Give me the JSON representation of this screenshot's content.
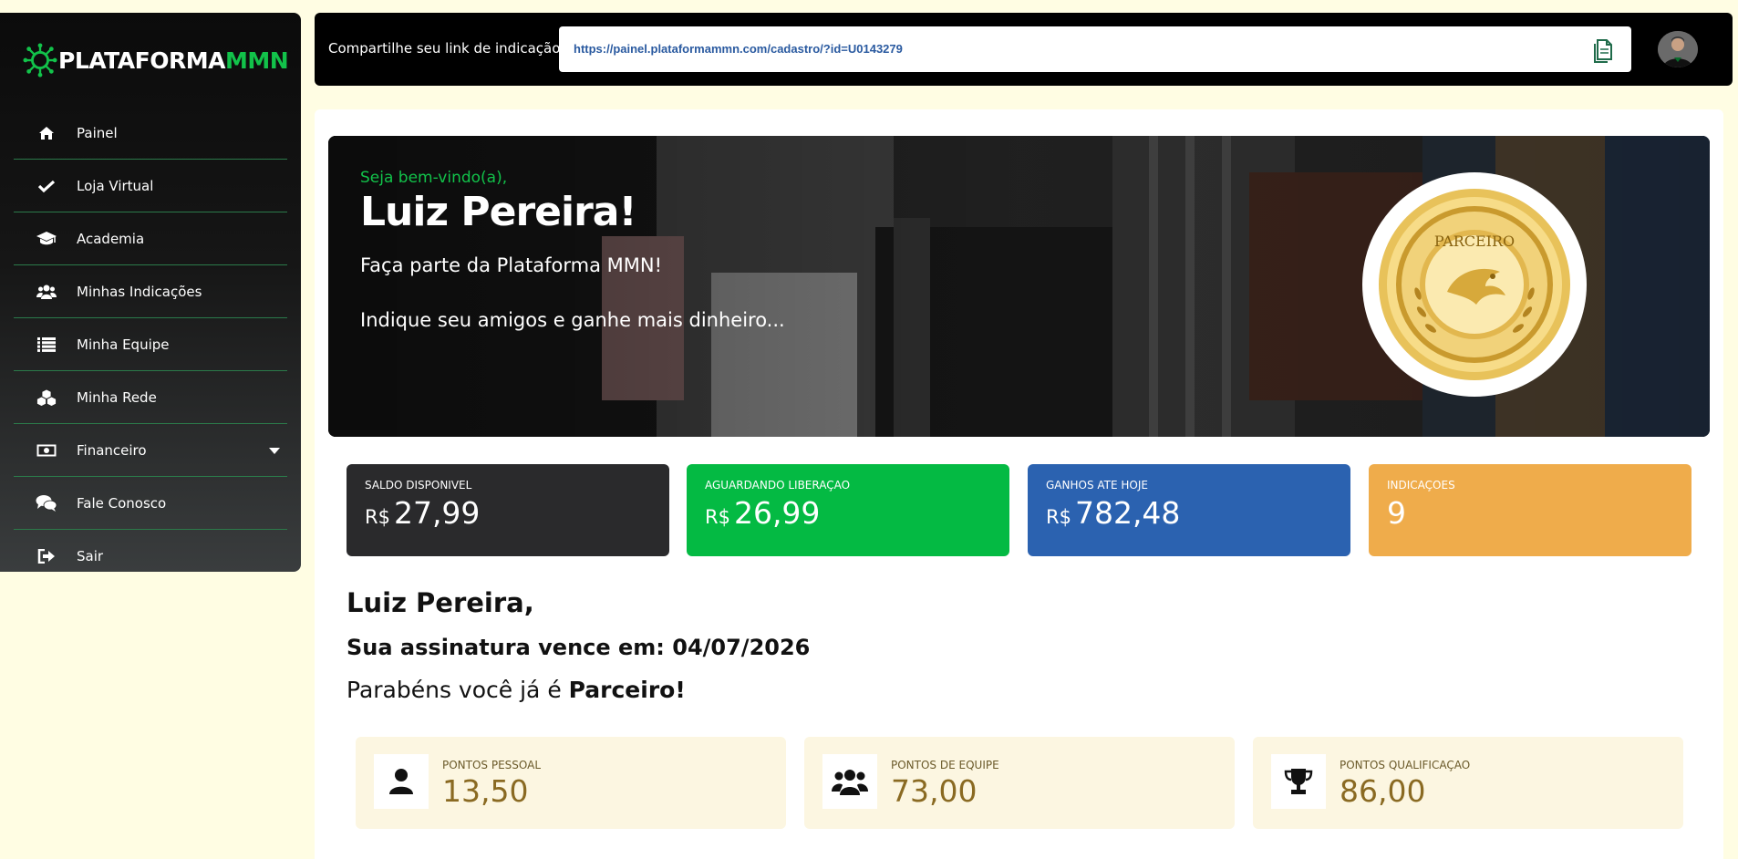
{
  "brand": {
    "name_part1": "PLATAFORMA",
    "name_part2": "MMN",
    "accent_color": "#12c24a"
  },
  "sidebar": {
    "items": [
      {
        "label": "Painel",
        "icon": "home-icon"
      },
      {
        "label": "Loja Virtual",
        "icon": "check-icon"
      },
      {
        "label": "Academia",
        "icon": "graduation-cap-icon"
      },
      {
        "label": "Minhas Indicações",
        "icon": "users-icon"
      },
      {
        "label": "Minha Equipe",
        "icon": "list-icon"
      },
      {
        "label": "Minha Rede",
        "icon": "cubes-icon"
      },
      {
        "label": "Financeiro",
        "icon": "money-icon",
        "has_submenu": true
      },
      {
        "label": "Fale Conosco",
        "icon": "chat-icon"
      },
      {
        "label": "Sair",
        "icon": "sign-out-icon"
      }
    ]
  },
  "topbar": {
    "share_label": "Compartilhe seu link de indicação:",
    "referral_link": "https://painel.plataformammn.com/cadastro/?id=U0143279"
  },
  "hero": {
    "welcome": "Seja bem-vindo(a),",
    "name": "Luiz Pereira!",
    "line1": "Faça parte da Plataforma MMN!",
    "line2": "Indique seu amigos e ganhe mais dinheiro...",
    "badge_text": "PARCEIRO"
  },
  "stats": [
    {
      "label": "SALDO DISPONIVEL",
      "currency": "R$",
      "value": "27,99",
      "color": "#2a2a2c"
    },
    {
      "label": "AGUARDANDO LIBERAÇAO",
      "currency": "R$",
      "value": "26,99",
      "color": "#04ba43"
    },
    {
      "label": "GANHOS ATE HOJE",
      "currency": "R$",
      "value": "782,48",
      "color": "#2b62b0"
    },
    {
      "label": "INDICAÇOES",
      "currency": "",
      "value": "9",
      "color": "#efac4b"
    }
  ],
  "summary": {
    "greeting": "Luiz Pereira,",
    "expiry": "Sua assinatura vence em: 04/07/2026",
    "congrats_prefix": "Parabéns você já é ",
    "congrats_level": "Parceiro!"
  },
  "points": [
    {
      "label": "PONTOS PESSOAL",
      "value": "13,50",
      "icon": "user-icon"
    },
    {
      "label": "PONTOS DE EQUIPE",
      "value": "73,00",
      "icon": "users-icon"
    },
    {
      "label": "PONTOS QUALIFICAÇAO",
      "value": "86,00",
      "icon": "trophy-icon"
    }
  ]
}
